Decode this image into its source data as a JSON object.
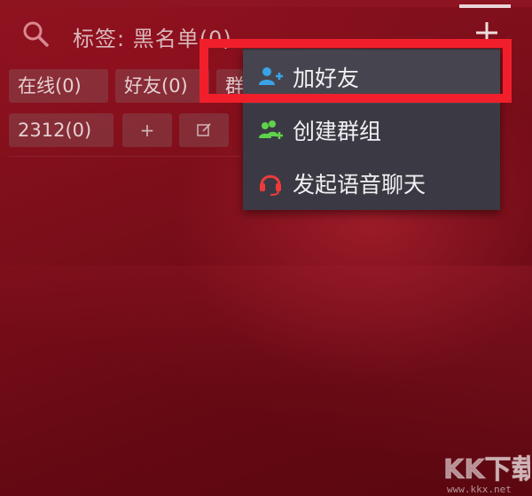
{
  "search": {
    "icon": "search-icon",
    "label": "标签: 黑名单(0)"
  },
  "header": {
    "add_icon": "plus-icon"
  },
  "tags": [
    {
      "label": "在线(0)"
    },
    {
      "label": "好友(0)"
    },
    {
      "label": "群"
    },
    {
      "label": "2312(0)"
    },
    {
      "label": "+"
    },
    {
      "label": "☐"
    }
  ],
  "menu": {
    "items": [
      {
        "label": "加好友",
        "icon": "add-friend-icon",
        "icon_color": "#3aa3e8"
      },
      {
        "label": "创建群组",
        "icon": "create-group-icon",
        "icon_color": "#5fd24b"
      },
      {
        "label": "发起语音聊天",
        "icon": "headset-icon",
        "icon_color": "#f03a3a"
      }
    ]
  },
  "highlight_color": "#f11f2c",
  "watermark": {
    "logo_text": "KK下载",
    "url": "www.kkx.net"
  }
}
